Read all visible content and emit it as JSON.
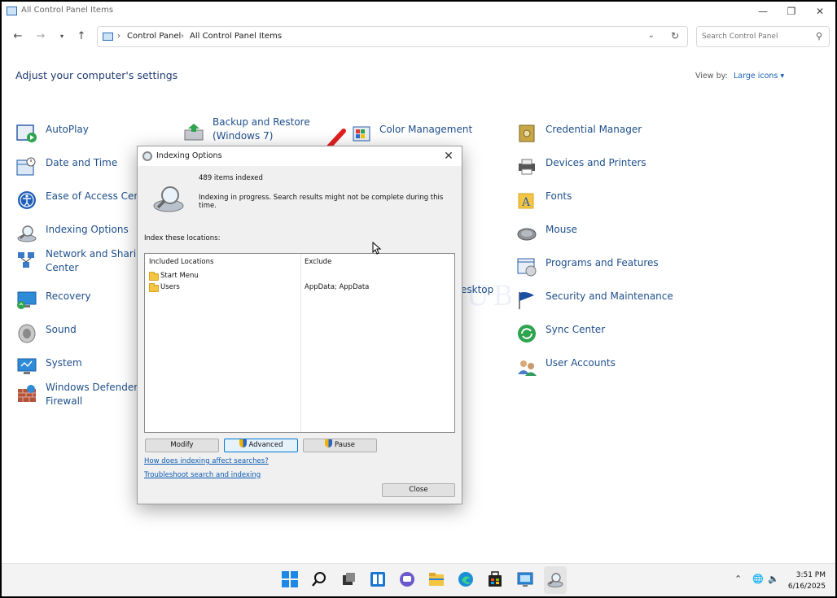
{
  "window": {
    "title": "All Control Panel Items"
  },
  "address": {
    "crumbs": [
      "Control Panel",
      "All Control Panel Items"
    ],
    "search_placeholder": "Search Control Panel"
  },
  "header": {
    "heading": "Adjust your computer's settings",
    "view_by_label": "View by:",
    "view_by_value": "Large icons ▾"
  },
  "items": {
    "autoplay": "AutoPlay",
    "backup_1": "Backup and Restore",
    "backup_2": "(Windows 7)",
    "color": "Color Management",
    "credential": "Credential Manager",
    "datetime": "Date and Time",
    "devices": "Devices and Printers",
    "ease": "Ease of Access Cent",
    "fonts": "Fonts",
    "indexing": "Indexing Options",
    "mouse": "Mouse",
    "network_1": "Network and Sharir",
    "network_2": "Center",
    "programs": "Programs and Features",
    "recovery": "Recovery",
    "desktop_partial": "esktop",
    "security": "Security and Maintenance",
    "sound": "Sound",
    "sync": "Sync Center",
    "system": "System",
    "user": "User Accounts",
    "firewall_1": "Windows Defender",
    "firewall_2": "Firewall"
  },
  "dialog": {
    "title": "Indexing Options",
    "items_indexed": "489 items indexed",
    "status": "Indexing in progress. Search results might not be complete during this time.",
    "locations_label": "Index these locations:",
    "col_included": "Included Locations",
    "col_exclude": "Exclude",
    "rows": [
      {
        "location": "Start Menu",
        "exclude": ""
      },
      {
        "location": "Users",
        "exclude": "AppData; AppData"
      }
    ],
    "buttons": {
      "modify": "Modify",
      "advanced": "Advanced",
      "pause": "Pause",
      "close": "Close"
    },
    "links": {
      "how": "How does indexing affect searches?",
      "troubleshoot": "Troubleshoot search and indexing"
    }
  },
  "watermark": "IT Pros HUB",
  "taskbar": {
    "time": "3:51 PM",
    "date": "6/16/2025"
  },
  "colors": {
    "link": "#1e4f8c",
    "accent": "#0078d4",
    "arrow": "#e02020"
  }
}
